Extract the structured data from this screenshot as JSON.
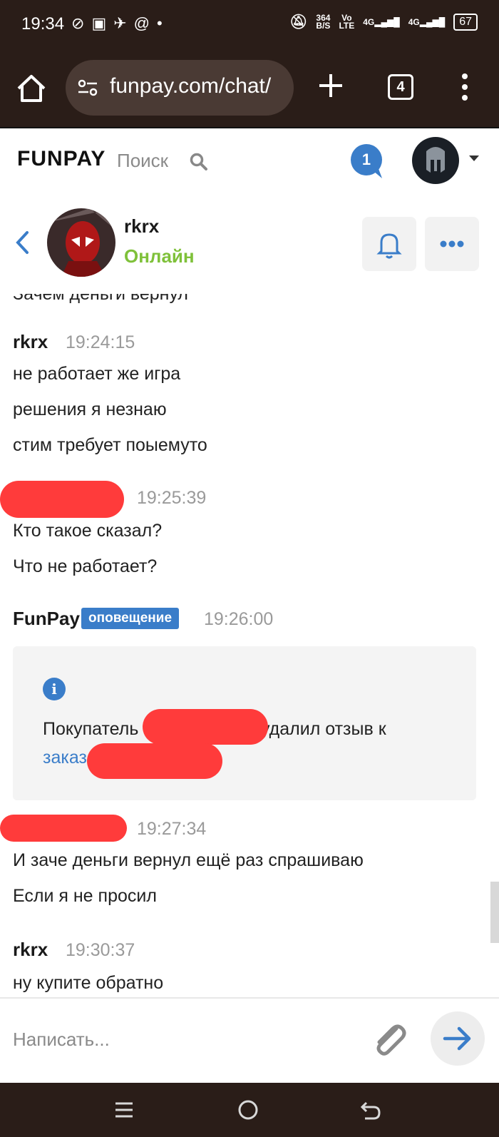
{
  "status_bar": {
    "time": "19:34",
    "net_speed": "364",
    "net_unit": "B/S",
    "volte_top": "Vo",
    "volte_bottom": "LTE",
    "net1": "4G",
    "net2": "4G",
    "battery": "67"
  },
  "browser": {
    "url": "funpay.com/chat/",
    "tab_count": "4"
  },
  "site_header": {
    "logo": "FUNPAY",
    "search_placeholder": "Поиск",
    "notification_count": "1"
  },
  "chat_header": {
    "peer_name": "rkrx",
    "peer_status": "Онлайн"
  },
  "messages": {
    "cut_top_text": "Зачем деньги вернул",
    "m1_author": "rkrx",
    "m1_time": "19:24:15",
    "m1_lines": [
      "не работает же игра",
      "решения я незнаю",
      "стим требует поыемуто"
    ],
    "m2_time": "19:25:39",
    "m2_lines": [
      "Кто такое сказал?",
      "Что не работает?"
    ],
    "m3_author": "FunPay",
    "m3_badge": "оповещение",
    "m3_time": "19:26:00",
    "m3_line1_start": "Покупатель",
    "m3_line1_end": "удалил отзыв к",
    "m3_line2_link": "заказ",
    "m4_time": "19:27:34",
    "m4_lines": [
      "И заче деньги вернул ещё раз спрашиваю",
      "Если я не просил"
    ],
    "m5_author": "rkrx",
    "m5_time": "19:30:37",
    "m5_cut_text": "ну купите обратно"
  },
  "composer": {
    "placeholder": "Написать..."
  },
  "colors": {
    "accent": "#3a7dc9",
    "online": "#7fc13a",
    "redaction": "#ff3b3b",
    "dark_chrome": "#2a1d18"
  }
}
